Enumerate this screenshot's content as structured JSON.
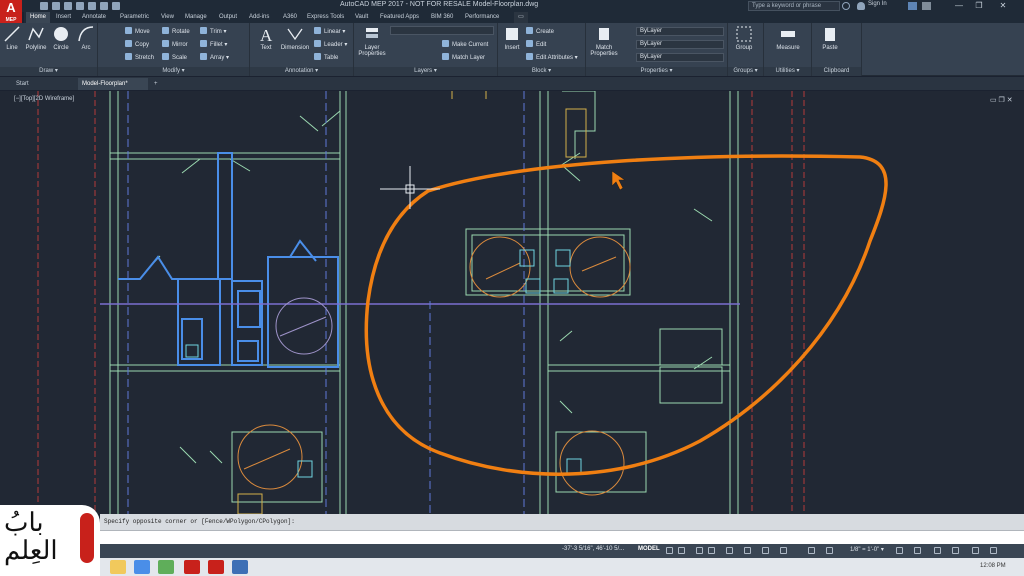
{
  "titlebar": {
    "logo": "A",
    "logo_sub": "MEP",
    "title": "AutoCAD MEP 2017 - NOT FOR RESALE    Model-Floorplan.dwg",
    "search_placeholder": "Type a keyword or phrase",
    "sign_in": "Sign In",
    "minimize": "—",
    "restore": "❐",
    "close": "✕"
  },
  "ribbon_tabs": [
    "Home",
    "Insert",
    "Annotate",
    "Parametric",
    "View",
    "Manage",
    "Output",
    "Add-ins",
    "A360",
    "Express Tools",
    "Vault",
    "Featured Apps",
    "BIM 360",
    "Performance"
  ],
  "ribbon": {
    "draw": {
      "title": "Draw ▾",
      "tools": [
        "Line",
        "Polyline",
        "Circle",
        "Arc"
      ]
    },
    "modify": {
      "title": "Modify ▾",
      "tools": [
        "Move",
        "Rotate",
        "Trim ▾",
        "Copy",
        "Mirror",
        "Fillet ▾",
        "Stretch",
        "Scale",
        "Array ▾"
      ]
    },
    "annotation": {
      "title": "Annotation ▾",
      "tools": [
        "Text",
        "Dimension",
        "Linear ▾",
        "Leader ▾",
        "Table"
      ]
    },
    "layers": {
      "title": "Layers ▾",
      "tools": [
        "Layer Properties",
        "Make Current",
        "Match Layer"
      ]
    },
    "block": {
      "title": "Block ▾",
      "tools": [
        "Insert",
        "Create",
        "Edit",
        "Edit Attributes ▾"
      ]
    },
    "properties": {
      "title": "Properties ▾",
      "tools": [
        "Match Properties",
        "ByLayer",
        "ByLayer",
        "ByLayer"
      ]
    },
    "groups": {
      "title": "Groups ▾",
      "tools": [
        "Group"
      ]
    },
    "utilities": {
      "title": "Utilities ▾",
      "tools": [
        "Measure"
      ]
    },
    "clipboard": {
      "title": "Clipboard",
      "tools": [
        "Paste"
      ]
    }
  },
  "file_tabs": [
    "Start",
    "Model-Floorplan*",
    "+"
  ],
  "viewport_label": "[−][Top][2D Wireframe]",
  "command_history": "Specify opposite corner or [Fence/WPolygon/CPolygon]:",
  "status": {
    "coords": "-37'-3 5/16\", 46'-10 5/...",
    "space": "MODEL",
    "scale": "1/8\" = 1'-0\" ▾",
    "clock": "12:08 PM"
  },
  "watermark": "بابُ العِلم",
  "colors": {
    "accent": "#c8211b",
    "annotation": "#f07f12",
    "walls": "#9bd9b0",
    "selected": "#4a8ee8"
  }
}
